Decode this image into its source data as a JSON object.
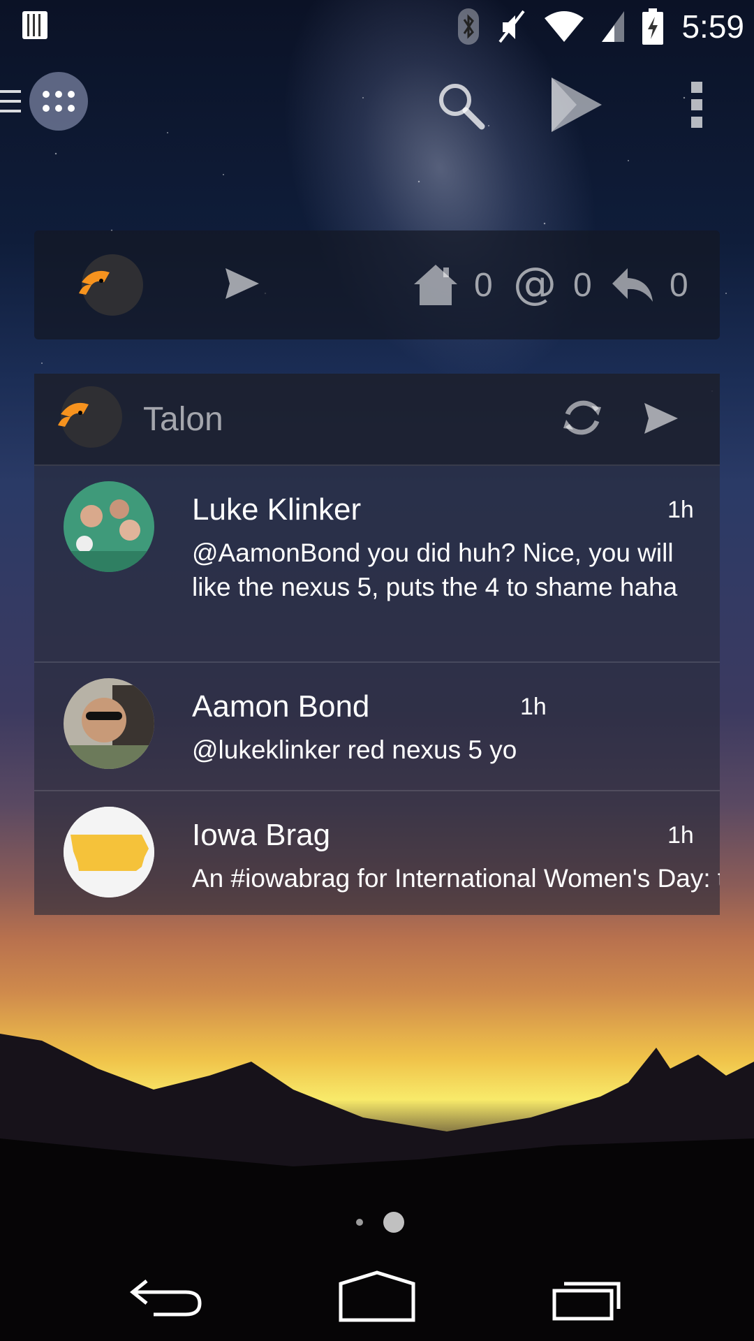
{
  "status_bar": {
    "time": "5:59",
    "icons": [
      "sim-card-icon",
      "bluetooth-icon",
      "mute-icon",
      "wifi-icon",
      "cell-signal-icon",
      "battery-charging-icon"
    ]
  },
  "top_bar": {
    "icons": [
      "drawer-handle-icon",
      "apps-grid-icon",
      "search-icon",
      "play-store-icon",
      "overflow-menu-icon"
    ]
  },
  "talon_mini_widget": {
    "home_count": "0",
    "mentions_count": "0",
    "replies_count": "0"
  },
  "talon_feed_widget": {
    "title": "Talon",
    "tweets": [
      {
        "name": "Luke Klinker",
        "time": "1h",
        "text": "@AamonBond you did huh? Nice, you will like the nexus 5, puts the 4 to shame haha"
      },
      {
        "name": "Aamon Bond",
        "time": "1h",
        "text": "@lukeklinker red nexus 5 yo"
      },
      {
        "name": "Iowa Brag",
        "time": "1h",
        "text": "An #iowabrag for International Women's Day: twitter.com/iowabrag/"
      }
    ]
  },
  "page_indicator": {
    "pages": 2,
    "current_page": 2
  },
  "nav_bar": {
    "icons": [
      "back-icon",
      "home-icon",
      "recents-icon"
    ]
  }
}
